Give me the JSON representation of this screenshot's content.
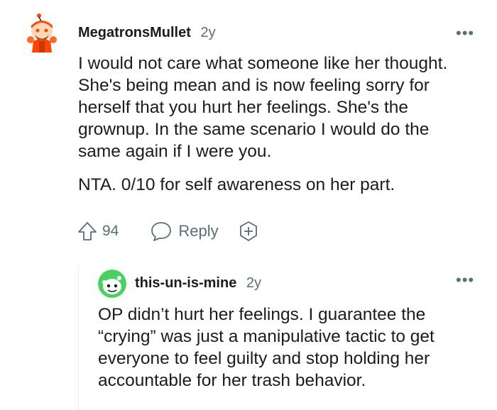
{
  "comments": [
    {
      "username": "MegatronsMullet",
      "age": "2y",
      "more": "•••",
      "paragraphs": [
        "I would not care what someone like her thought. She's being mean and is now feeling sorry for herself that you hurt her feelings. She's the grownup. In the same scenario I would do the same again if I were you.",
        "NTA. 0/10 for self awareness on her part."
      ],
      "votes": "94",
      "reply_label": "Reply"
    },
    {
      "username": "this-un-is-mine",
      "age": "2y",
      "more": "•••",
      "paragraphs": [
        "OP didn’t hurt her feelings. I guarantee the “crying” was just a manipulative tactic to get everyone to feel guilty and stop holding her accountable for her trash behavior."
      ]
    }
  ],
  "colors": {
    "text": "#1c1c1c",
    "meta": "#576f76",
    "avatar_accent": "#ff4500",
    "avatar_teal": "#46d160"
  },
  "icons": [
    "upvote-icon",
    "comment-bubble-icon",
    "award-plus-icon",
    "more-options-icon"
  ]
}
